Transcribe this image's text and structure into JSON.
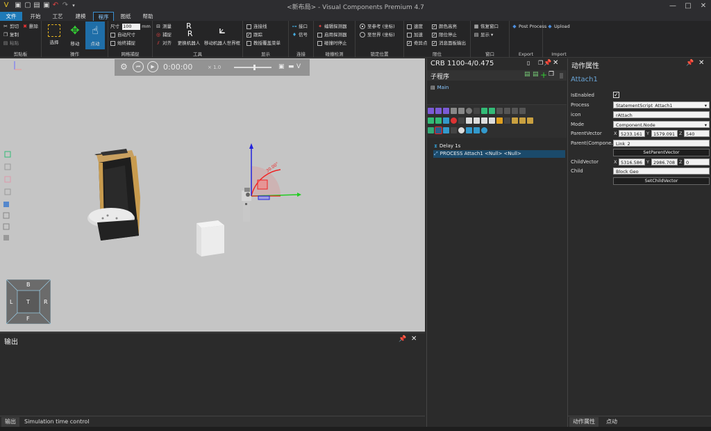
{
  "window": {
    "title": "<新布局> - Visual Components Premium 4.7",
    "minimize": "—",
    "maximize": "□",
    "close": "✕"
  },
  "menu": {
    "tabs": [
      "文件",
      "开始",
      "工艺",
      "建模",
      "程序",
      "图纸",
      "帮助"
    ]
  },
  "ribbon": {
    "clipboard": {
      "label": "剪贴板",
      "cut": "剪切",
      "delete": "删除",
      "copy": "复制",
      "paste": "粘贴"
    },
    "operate": {
      "label": "操作",
      "select": "选择",
      "move": "移动",
      "jog": "点动"
    },
    "grid_snap": {
      "label": "网格捕捉",
      "size_label": "尺寸",
      "size_value": "100",
      "size_unit": "mm",
      "auto_size": "自动尺寸",
      "always_snap": "始终捕捉"
    },
    "tools": {
      "label": "工具",
      "measure": "测量",
      "snap": "捕捉",
      "align": "对齐",
      "swap_robot": "更换机器人",
      "move_robot_world": "移动机器人世界框"
    },
    "display": {
      "label": "显示",
      "connect_line": "连接线",
      "trace": "跟踪",
      "teach_menu": "教授覆盖菜单"
    },
    "connect": {
      "label": "连接",
      "interface": "接口",
      "signal": "信号"
    },
    "collision": {
      "label": "碰撞检测",
      "edit_detector": "编辑探测器",
      "enable_detector": "启用探测器",
      "stop_on_collision": "碰撞时停止"
    },
    "lock_position": {
      "label": "锁定位置",
      "to_ref": "至参考 (坐标)",
      "to_world": "至世界 (坐标)"
    },
    "limits": {
      "label": "限位",
      "speed": "速度",
      "accel": "加速",
      "singularity": "奇异点",
      "color_highlight": "颜色高亮",
      "limit_stop": "限位停止",
      "msg_output": "消息面板输出"
    },
    "window_group": {
      "label": "窗口",
      "restore": "恢复窗口",
      "show": "显示"
    },
    "export": {
      "label": "Export",
      "post_process": "Post Process"
    },
    "import": {
      "label": "Import",
      "upload": "Upload"
    }
  },
  "sim": {
    "time": "0:00:00",
    "speed": "1.0"
  },
  "navcube": {
    "top": "B",
    "left": "L",
    "center": "T",
    "right": "R",
    "bottom": "F"
  },
  "output_panel": {
    "title": "输出",
    "tabs": [
      "输出",
      "Simulation time control"
    ]
  },
  "program_panel": {
    "title": "CRB 1100-4/0.475",
    "section": "子程序",
    "routine": "Main",
    "statements": [
      {
        "text": "Delay 1s",
        "selected": false
      },
      {
        "text": "PROCESS Attach1 <Null> <Null>",
        "selected": true
      }
    ]
  },
  "props_panel": {
    "title": "动作属性",
    "name": "Attach1",
    "fields": {
      "isenabled_label": "IsEnabled",
      "process_label": "Process",
      "process_value": "StatementScript_Attach1",
      "icon_label": "icon",
      "icon_value": "rAttach",
      "mode_label": "Mode",
      "mode_value": "Component.Node",
      "parentvector_label": "ParentVector",
      "pv_x": "5233.161",
      "pv_y": "1579.091",
      "pv_z": "540",
      "parentcomp_label": "Parent(Compone...",
      "parentcomp_value": "Link_2",
      "setparent_btn": "SetParentVector",
      "childvector_label": "ChildVector",
      "cv_x": "5316.586",
      "cv_y": "2986.708",
      "cv_z": "0",
      "child_label": "Child",
      "child_value": "Block Geo",
      "setchild_btn": "SetChildVector"
    },
    "tabs": [
      "动作属性",
      "点动"
    ]
  },
  "colors": {
    "accent": "#1f7ab8",
    "viewport_bg": "#c5c5c5",
    "selected_row": "#1b4a6b"
  }
}
